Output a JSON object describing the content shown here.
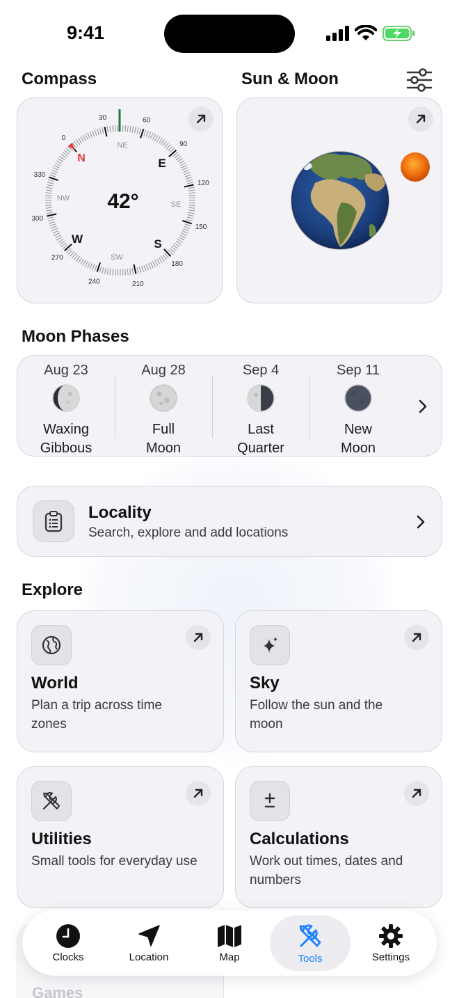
{
  "status": {
    "time": "9:41"
  },
  "header": {
    "compass_title": "Compass",
    "sunmoon_title": "Sun & Moon"
  },
  "compass": {
    "heading": "42°",
    "cardinals": {
      "n": "N",
      "e": "E",
      "s": "S",
      "w": "W"
    },
    "intercardinals": {
      "ne": "NE",
      "se": "SE",
      "sw": "SW",
      "nw": "NW"
    },
    "degree_labels": [
      "0",
      "30",
      "60",
      "90",
      "120",
      "150",
      "180",
      "210",
      "240",
      "270",
      "300",
      "330"
    ],
    "colors": {
      "north": "#e53935",
      "heading": "#1f7a3a"
    }
  },
  "moon_phases": {
    "title": "Moon Phases",
    "items": [
      {
        "date": "Aug 23",
        "name1": "Waxing",
        "name2": "Gibbous",
        "phase": "waxing-gibbous"
      },
      {
        "date": "Aug 28",
        "name1": "Full",
        "name2": "Moon",
        "phase": "full"
      },
      {
        "date": "Sep 4",
        "name1": "Last",
        "name2": "Quarter",
        "phase": "last-quarter"
      },
      {
        "date": "Sep 11",
        "name1": "New",
        "name2": "Moon",
        "phase": "new"
      }
    ]
  },
  "locality": {
    "title": "Locality",
    "subtitle": "Search, explore and add locations"
  },
  "explore": {
    "title": "Explore",
    "tiles": [
      {
        "title": "World",
        "subtitle": "Plan a trip across time zones",
        "icon": "globe-icon"
      },
      {
        "title": "Sky",
        "subtitle": "Follow the sun and the moon",
        "icon": "sparkles-icon"
      },
      {
        "title": "Utilities",
        "subtitle": "Small tools for everyday use",
        "icon": "tools-icon"
      },
      {
        "title": "Calculations",
        "subtitle": "Work out times, dates and numbers",
        "icon": "plus-minus-icon"
      }
    ],
    "partial_tile_title": "Games"
  },
  "tabbar": {
    "active": "Tools",
    "accent": "#1d82ff",
    "items": [
      {
        "label": "Clocks",
        "icon": "clock-icon"
      },
      {
        "label": "Location",
        "icon": "location-arrow-icon"
      },
      {
        "label": "Map",
        "icon": "map-icon"
      },
      {
        "label": "Tools",
        "icon": "tools-icon"
      },
      {
        "label": "Settings",
        "icon": "gear-icon"
      }
    ]
  }
}
